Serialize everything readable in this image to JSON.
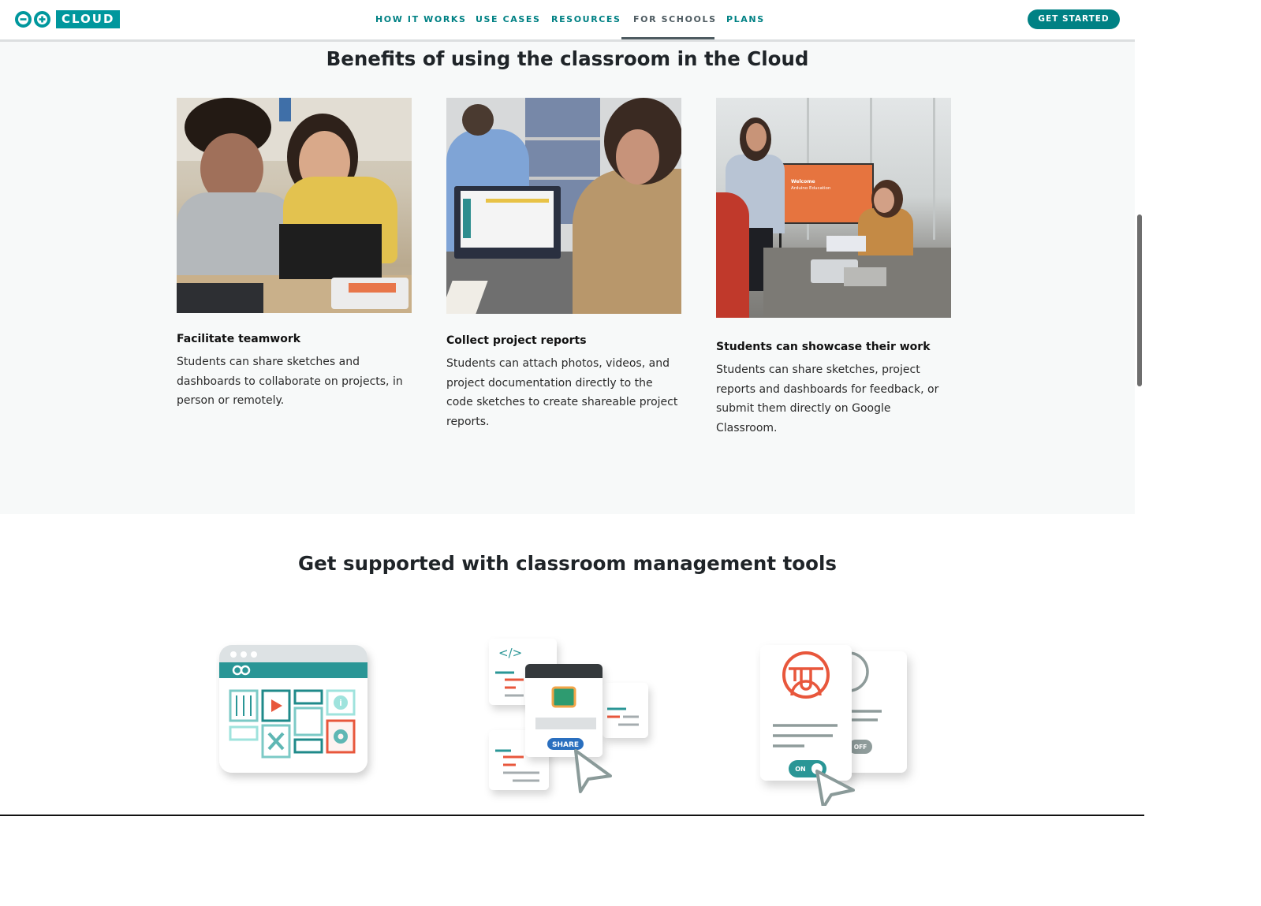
{
  "header": {
    "logo_text": "CLOUD",
    "nav": [
      {
        "label": "HOW IT WORKS",
        "active": false
      },
      {
        "label": "USE CASES",
        "active": false
      },
      {
        "label": "RESOURCES",
        "active": false
      },
      {
        "label": "FOR SCHOOLS",
        "active": true
      },
      {
        "label": "PLANS",
        "active": false
      }
    ],
    "cta_label": "GET STARTED"
  },
  "benefits": {
    "title": "Benefits of using the classroom in the Cloud",
    "cards": [
      {
        "image": "students-building-robot-photo",
        "title": "Facilitate teamwork",
        "text": "Students can share sketches and dashboards to collaborate on projects, in person or remotely."
      },
      {
        "image": "student-on-laptop-photo",
        "title": "Collect project reports",
        "text": "Students can attach photos, videos, and project documentation directly to the code sketches to create shareable project reports."
      },
      {
        "image": "classroom-presentation-photo",
        "title": "Students can showcase their work",
        "text": "Students can share sketches, project reports and dashboards for feedback, or submit them directly on Google Classroom.",
        "screen_title": "Welcome",
        "screen_subtitle": "Arduino Education"
      }
    ]
  },
  "tools": {
    "title": "Get supported with classroom management tools",
    "illustrations": [
      {
        "name": "dashboard-widgets-illustration"
      },
      {
        "name": "share-sketch-illustration",
        "button_label": "SHARE"
      },
      {
        "name": "student-toggle-illustration",
        "on_label": "ON",
        "off_label": "OFF"
      }
    ]
  },
  "colors": {
    "brand_teal": "#008184",
    "logo_teal": "#00979d",
    "accent_orange": "#e8573c",
    "active_nav": "#4e5b61",
    "section_bg": "#f7f9f9"
  }
}
